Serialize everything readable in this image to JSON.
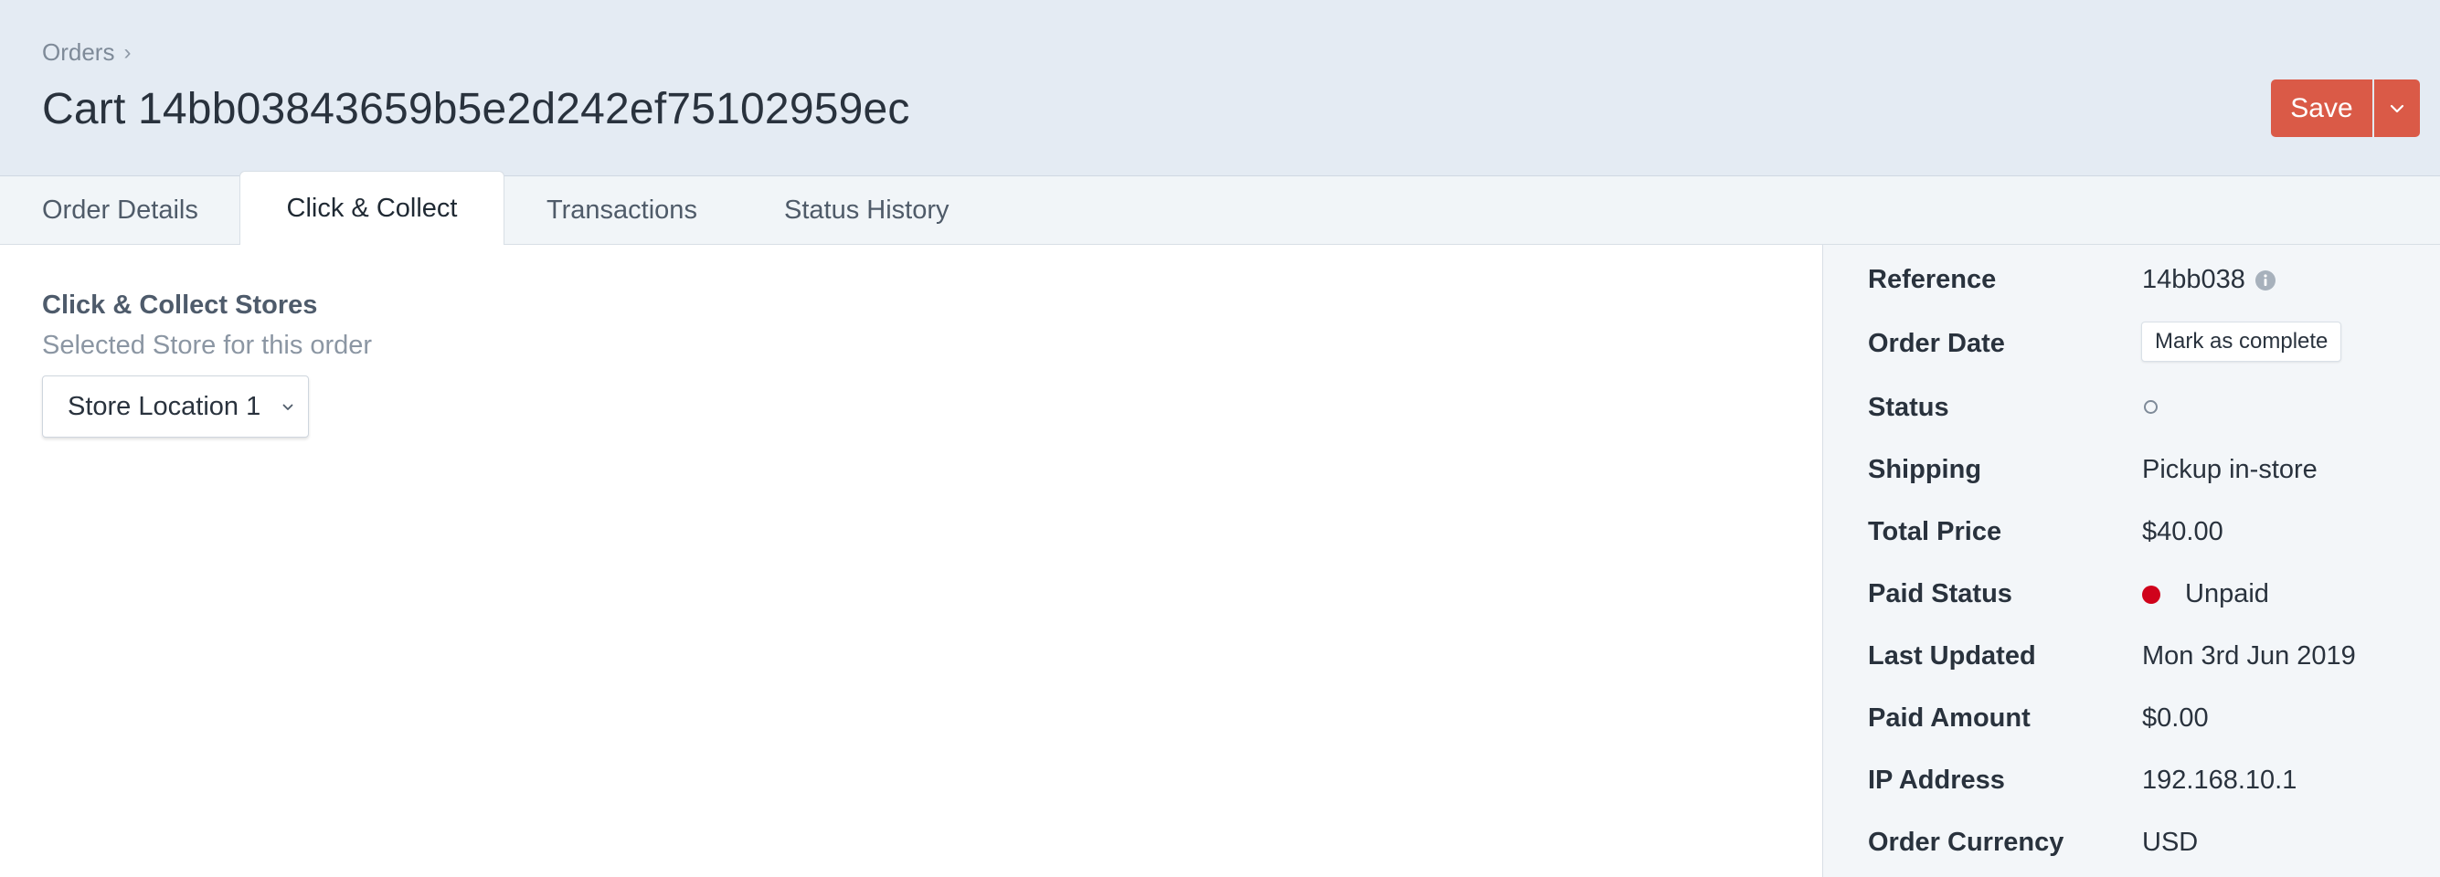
{
  "header": {
    "breadcrumb": "Orders",
    "breadcrumb_sep": "›",
    "title": "Cart 14bb03843659b5e2d242ef75102959ec",
    "save_label": "Save"
  },
  "tabs": [
    {
      "label": "Order Details",
      "active": false
    },
    {
      "label": "Click & Collect",
      "active": true
    },
    {
      "label": "Transactions",
      "active": false
    },
    {
      "label": "Status History",
      "active": false
    }
  ],
  "main": {
    "section_title": "Click & Collect Stores",
    "section_subtitle": "Selected Store for this order",
    "store_select_value": "Store Location 1"
  },
  "sidebar": {
    "reference_label": "Reference",
    "reference_value": "14bb038",
    "order_date_label": "Order Date",
    "mark_complete_label": "Mark as complete",
    "status_label": "Status",
    "shipping_label": "Shipping",
    "shipping_value": "Pickup in-store",
    "total_price_label": "Total Price",
    "total_price_value": "$40.00",
    "paid_status_label": "Paid Status",
    "paid_status_value": "Unpaid",
    "last_updated_label": "Last Updated",
    "last_updated_value": "Mon 3rd Jun 2019",
    "paid_amount_label": "Paid Amount",
    "paid_amount_value": "$0.00",
    "ip_address_label": "IP Address",
    "ip_address_value": "192.168.10.1",
    "order_currency_label": "Order Currency",
    "order_currency_value": "USD"
  },
  "icons": {
    "save_menu": "chevron-down-icon",
    "select": "chevron-down-icon",
    "reference_info": "info-icon",
    "status": "empty-circle-icon",
    "paid_status": "red-dot-icon"
  },
  "colors": {
    "header_bg": "#e4ebf3",
    "save_button": "#da5a47",
    "unpaid_dot": "#d0021b",
    "sidebar_bg": "#f3f6f9"
  }
}
